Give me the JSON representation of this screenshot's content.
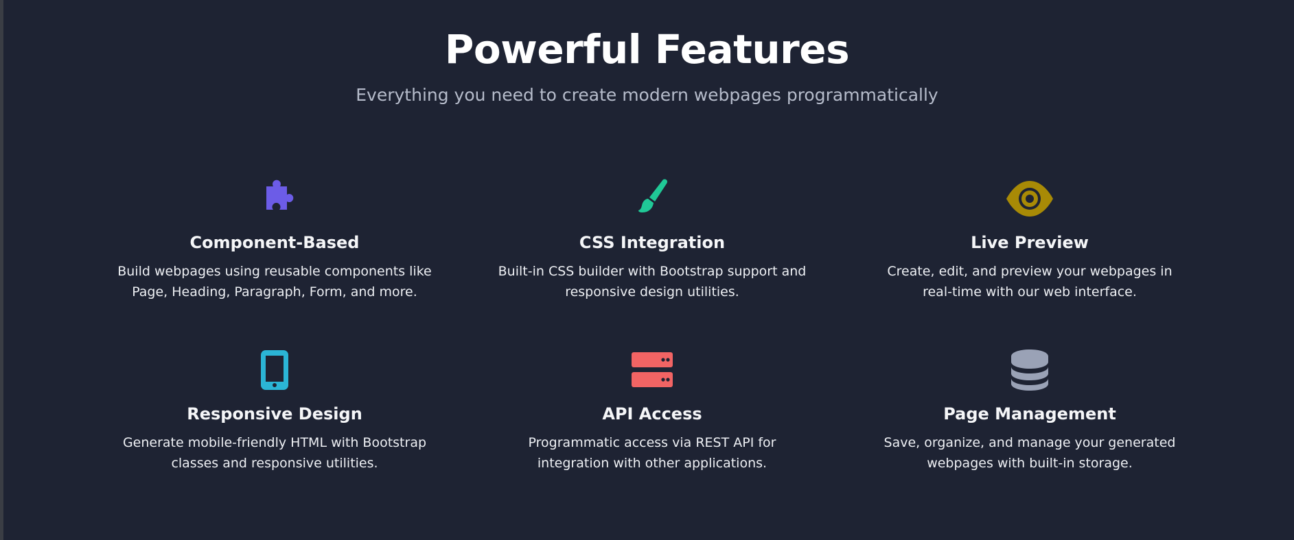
{
  "header": {
    "title": "Powerful Features",
    "subtitle": "Everything you need to create modern webpages programmatically"
  },
  "features": [
    {
      "icon": "puzzle-piece-icon",
      "color": "#6c5ce7",
      "title": "Component-Based",
      "description": "Build webpages using reusable components like Page, Heading, Paragraph, Form, and more."
    },
    {
      "icon": "paintbrush-icon",
      "color": "#20c997",
      "title": "CSS Integration",
      "description": "Built-in CSS builder with Bootstrap support and responsive design utilities."
    },
    {
      "icon": "eye-icon",
      "color": "#a88a06",
      "title": "Live Preview",
      "description": "Create, edit, and preview your webpages in real-time with our web interface."
    },
    {
      "icon": "mobile-phone-icon",
      "color": "#2bb5d6",
      "title": "Responsive Design",
      "description": "Generate mobile-friendly HTML with Bootstrap classes and responsive utilities."
    },
    {
      "icon": "server-icon",
      "color": "#f26464",
      "title": "API Access",
      "description": "Programmatic access via REST API for integration with other applications."
    },
    {
      "icon": "database-icon",
      "color": "#9aa2b6",
      "title": "Page Management",
      "description": "Save, organize, and manage your generated webpages with built-in storage."
    }
  ]
}
